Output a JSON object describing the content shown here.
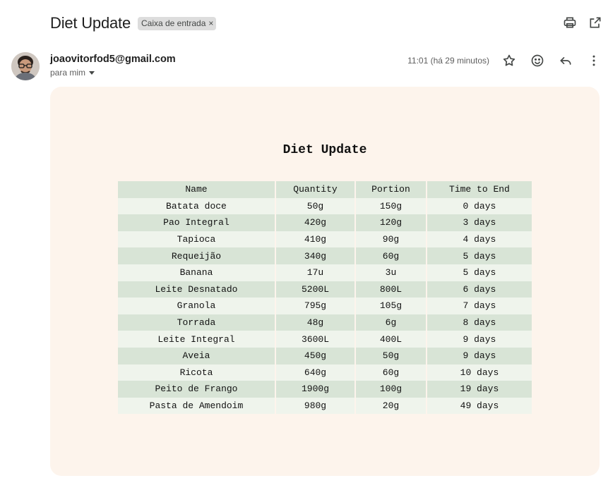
{
  "email": {
    "subject": "Diet Update",
    "label": "Caixa de entrada",
    "label_remove": "×",
    "sender": "joaovitorfod5@gmail.com",
    "recipient_line": "para mim",
    "time": "11:01 (há 29 minutos)"
  },
  "body": {
    "title": "Diet Update",
    "columns": [
      "Name",
      "Quantity",
      "Portion",
      "Time to End"
    ],
    "rows": [
      [
        "Batata doce",
        "50g",
        "150g",
        "0 days"
      ],
      [
        "Pao Integral",
        "420g",
        "120g",
        "3 days"
      ],
      [
        "Tapioca",
        "410g",
        "90g",
        "4 days"
      ],
      [
        "Requeijão",
        "340g",
        "60g",
        "5 days"
      ],
      [
        "Banana",
        "17u",
        "3u",
        "5 days"
      ],
      [
        "Leite Desnatado",
        "5200L",
        "800L",
        "6 days"
      ],
      [
        "Granola",
        "795g",
        "105g",
        "7 days"
      ],
      [
        "Torrada",
        "48g",
        "6g",
        "8 days"
      ],
      [
        "Leite Integral",
        "3600L",
        "400L",
        "9 days"
      ],
      [
        "Aveia",
        "450g",
        "50g",
        "9 days"
      ],
      [
        "Ricota",
        "640g",
        "60g",
        "10 days"
      ],
      [
        "Peito de Frango",
        "1900g",
        "100g",
        "19 days"
      ],
      [
        "Pasta de Amendoim",
        "980g",
        "20g",
        "49 days"
      ]
    ]
  },
  "icons": {
    "print": "print-icon",
    "open_new_window": "open-in-new-window-icon",
    "star": "star-icon",
    "emoji": "emoji-reaction-icon",
    "reply": "reply-icon",
    "more": "more-vertical-icon"
  },
  "colors": {
    "card_background": "#fdf4ec",
    "row_dark": "#d8e4d6",
    "row_light": "#eff4ec",
    "label_chip": "#dddddd"
  }
}
